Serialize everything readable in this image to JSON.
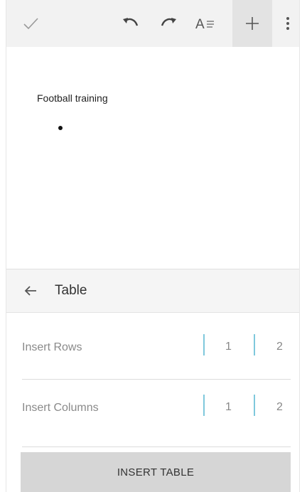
{
  "toolbar": {
    "icons": [
      "check-icon",
      "undo-icon",
      "redo-icon",
      "text-format-icon",
      "plus-icon",
      "more-vert-icon"
    ]
  },
  "document": {
    "title": "Football training"
  },
  "panel": {
    "title": "Table",
    "rows": [
      {
        "label": "Insert Rows",
        "options": [
          "1",
          "2"
        ]
      },
      {
        "label": "Insert Columns",
        "options": [
          "1",
          "2"
        ]
      }
    ],
    "insert_button": "INSERT TABLE"
  },
  "colors": {
    "toolbar_bg": "#f2f2f2",
    "separator_accent": "#7fc8dc",
    "button_bg": "#d6d6d6"
  }
}
